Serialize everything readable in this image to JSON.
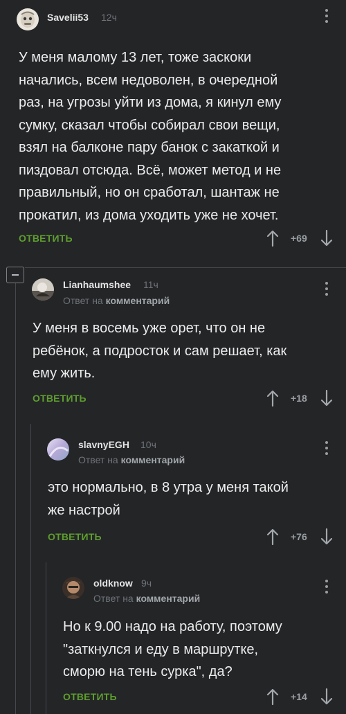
{
  "comments": [
    {
      "username": "Savelii53",
      "time": "12ч",
      "reply_meta_prefix": "",
      "reply_meta_strong": "",
      "lines": [
        "У меня малому 13 лет, тоже заскоки",
        "начались, всем недоволен, в очередной",
        "раз, на угрозы уйти из дома, я кинул ему",
        "сумку, сказал чтобы собирал свои вещи,",
        "взял на балконе пару банок с закаткой и",
        "пиздовал отсюда. Всё, может метод и не",
        "правильный, но он сработал, шантаж не",
        "прокатил, из дома уходить уже не хочет."
      ],
      "reply_label": "ОТВЕТИТЬ",
      "score": "+69"
    },
    {
      "username": "Lianhaumshee",
      "time": "11ч",
      "reply_meta_prefix": "Ответ на",
      "reply_meta_strong": "комментарий",
      "lines": [
        "У меня в восемь уже орет,  что он не",
        "ребёнок,  а подросток и сам решает,  как",
        "ему жить."
      ],
      "reply_label": "ОТВЕТИТЬ",
      "score": "+18"
    },
    {
      "username": "slavnyEGH",
      "time": "10ч",
      "reply_meta_prefix": "Ответ на",
      "reply_meta_strong": "комментарий",
      "lines": [
        "это нормально, в 8 утра у меня такой",
        "же настрой"
      ],
      "reply_label": "ОТВЕТИТЬ",
      "score": "+76"
    },
    {
      "username": "oldknow",
      "time": "9ч",
      "reply_meta_prefix": "Ответ на",
      "reply_meta_strong": "комментарий",
      "lines": [
        "Но к 9.00 надо на работу, поэтому",
        "\"заткнулся и еду в маршрутке,",
        "сморю на тень сурка\", да?"
      ],
      "reply_label": "ОТВЕТИТЬ",
      "score": "+14"
    }
  ],
  "colors": {
    "background": "#232527",
    "accent_green": "#5f9e2e",
    "muted": "#6f7378"
  },
  "icons": [
    "avatar",
    "more-vertical-icon",
    "arrow-up-icon",
    "arrow-down-icon",
    "collapse-minus-icon"
  ]
}
